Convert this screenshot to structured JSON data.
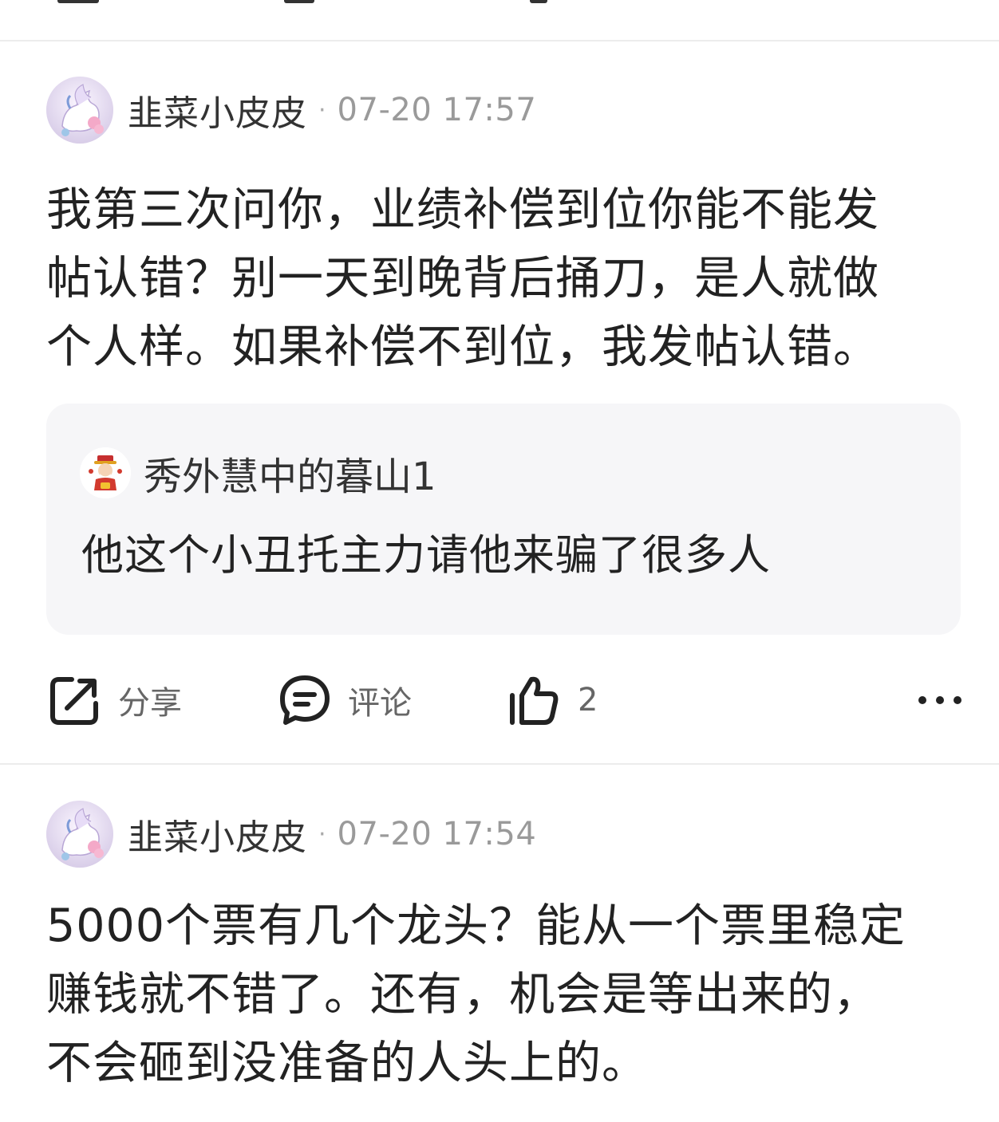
{
  "posts": [
    {
      "author": "韭菜小皮皮",
      "separator": "·",
      "time": "07-20 17:57",
      "avatar_icon": "pegasus-avatar-icon",
      "body": "我第三次问你，业绩补偿到位你能不能发\n帖认错？别一天到晚背后捅刀，是人就做\n个人样。如果补偿不到位，我发帖认错。",
      "quote": {
        "author": "秀外慧中的暮山1",
        "avatar_icon": "fortune-god-avatar-icon",
        "text": "他这个小丑托主力请他来骗了很多人"
      },
      "actions": {
        "share_label": "分享",
        "comment_label": "评论",
        "like_count": "2"
      }
    },
    {
      "author": "韭菜小皮皮",
      "separator": "·",
      "time": "07-20 17:54",
      "avatar_icon": "pegasus-avatar-icon",
      "body": "5000个票有几个龙头？能从一个票里稳定\n赚钱就不错了。还有，机会是等出来的，\n不会砸到没准备的人头上的。"
    }
  ],
  "icons": {
    "share": "share-icon",
    "comment": "comment-icon",
    "like": "thumbs-up-icon",
    "more": "more-dots-icon"
  },
  "colors": {
    "text_primary": "#222222",
    "text_meta": "#9a9a9a",
    "quote_bg": "#f6f6f8",
    "divider": "#ececec"
  }
}
